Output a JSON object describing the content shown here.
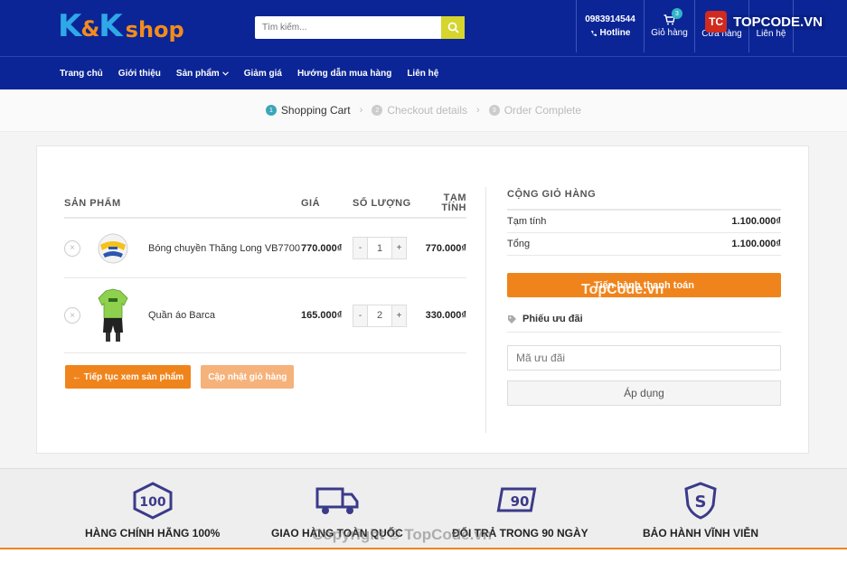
{
  "brand": {
    "logo_kk": "K",
    "logo_amp": "&",
    "logo_k2": "K",
    "logo_shop": "shop"
  },
  "search": {
    "placeholder": "Tìm kiếm..."
  },
  "header": {
    "phone": "0983914544",
    "hotline": "Hotline",
    "cart_count": "3",
    "cart_label": "Giỏ hàng",
    "store_label": "Cửa hàng",
    "contact_label": "Liên hệ",
    "watermark_badge": "TC",
    "watermark_text": "TOPCODE.VN"
  },
  "nav": {
    "items": [
      "Trang chủ",
      "Giới thiệu",
      "Sản phẩm",
      "Giảm giá",
      "Hướng dẫn mua hàng",
      "Liên hệ"
    ]
  },
  "steps": [
    {
      "num": "1",
      "label": "Shopping Cart"
    },
    {
      "num": "2",
      "label": "Checkout details"
    },
    {
      "num": "3",
      "label": "Order Complete"
    }
  ],
  "cart": {
    "headers": {
      "product": "SẢN PHẨM",
      "price": "GIÁ",
      "qty": "SỐ LƯỢNG",
      "subtotal_1": "TẠM",
      "subtotal_2": "TÍNH"
    },
    "items": [
      {
        "name": "Bóng chuyền Thăng Long VB7700",
        "price": "770.000₫",
        "qty": "1",
        "subtotal": "770.000₫"
      },
      {
        "name": "Quần áo Barca",
        "price": "165.000₫",
        "qty": "2",
        "subtotal": "330.000₫"
      }
    ],
    "continue_label": "← Tiếp tục xem sản phẩm",
    "update_label": "Cập nhật giỏ hàng"
  },
  "totals": {
    "title": "CỘNG GIỎ HÀNG",
    "subtotal_label": "Tạm tính",
    "subtotal_value": "1.100.000₫",
    "total_label": "Tổng",
    "total_value": "1.100.000₫",
    "checkout_label": "Tiến hành thanh toán",
    "coupon_title": "Phiếu ưu đãi",
    "coupon_placeholder": "Mã ưu đãi",
    "apply_label": "Áp dụng"
  },
  "features": [
    {
      "icon_text": "100",
      "label": "HÀNG CHÍNH HÃNG 100%"
    },
    {
      "icon_text": "",
      "label": "GIAO HÀNG TOÀN QUỐC"
    },
    {
      "icon_text": "90",
      "label": "ĐỔI TRẢ TRONG 90 NGÀY"
    },
    {
      "icon_text": "S",
      "label": "BẢO HÀNH VĨNH VIỄN"
    }
  ],
  "watermarks": {
    "mid": "TopCode.vn",
    "bottom": "Copyright © TopCode.vn"
  }
}
